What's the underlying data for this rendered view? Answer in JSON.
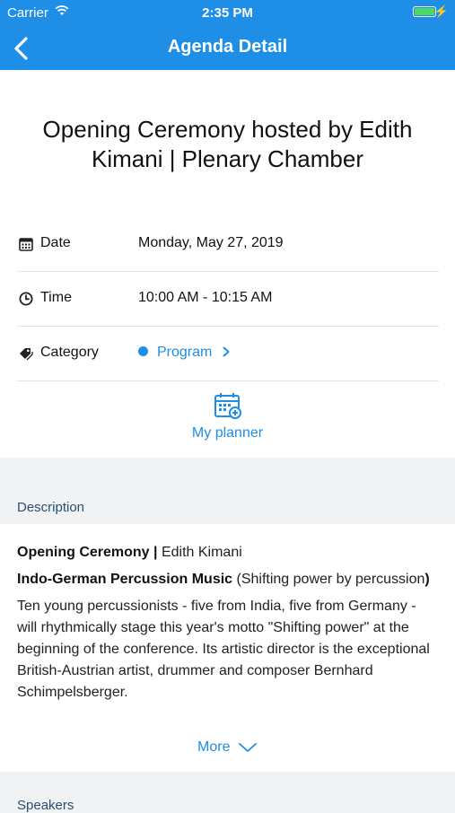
{
  "status_bar": {
    "carrier": "Carrier",
    "time": "2:35 PM",
    "battery_color": "#4cd964"
  },
  "nav": {
    "title": "Agenda Detail",
    "back_icon": "chevron-left-icon"
  },
  "event": {
    "title": "Opening Ceremony hosted by Edith Kimani | Plenary Chamber",
    "rows": [
      {
        "icon": "calendar-icon",
        "label": "Date",
        "value": "Monday, May 27, 2019"
      },
      {
        "icon": "clock-icon",
        "label": "Time",
        "value": "10:00 AM - 10:15 AM"
      },
      {
        "icon": "tag-icon",
        "label": "Category",
        "value": "Program"
      }
    ],
    "planner_label": "My planner"
  },
  "description": {
    "section_title": "Description",
    "heading_bold": "Opening Ceremony |",
    "heading_normal": " Edith Kimani",
    "subtitle_bold": "Indo-German Percussion Music",
    "subtitle_normal": " (Shifting power by percussion",
    "subtitle_close": ")",
    "body": "Ten young percussionists - five from India, five from Germany - will rhythmically stage this year's motto \"Shifting power\" at the beginning of the conference. Its artistic director is the exceptional British-Austrian artist, drummer and composer Bernhard Schimpelsberger.",
    "more_label": "More"
  },
  "next_section_peek": "Speakers",
  "colors": {
    "accent": "#1e8ee6",
    "section_title": "#2a4f72",
    "background": "#f1f2f4"
  }
}
